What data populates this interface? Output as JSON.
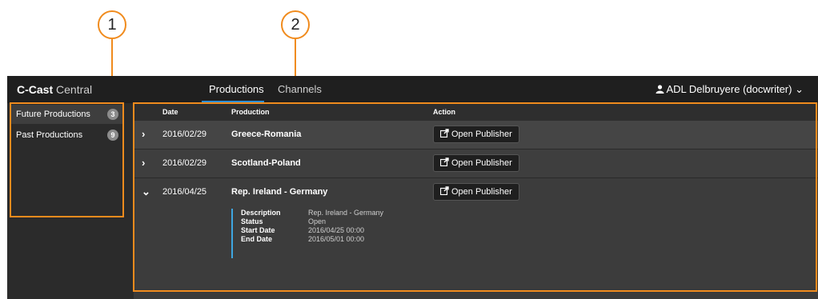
{
  "callouts": [
    "1",
    "2"
  ],
  "app": {
    "brand_bold": "C-Cast",
    "brand_light": "Central",
    "nav": [
      {
        "label": "Productions",
        "active": true
      },
      {
        "label": "Channels",
        "active": false
      }
    ],
    "user": {
      "icon": "user-icon",
      "label": "ADL Delbruyere (docwriter)",
      "caret": "⌄"
    }
  },
  "sidebar": {
    "items": [
      {
        "label": "Future Productions",
        "count": "3",
        "active": true
      },
      {
        "label": "Past Productions",
        "count": "9",
        "active": false
      }
    ]
  },
  "table": {
    "headers": {
      "date": "Date",
      "production": "Production",
      "action": "Action"
    },
    "action_button": {
      "icon": "external-link-icon",
      "label": "Open Publisher"
    },
    "rows": [
      {
        "chevron": "›",
        "date": "2016/02/29",
        "production": "Greece-Romania"
      },
      {
        "chevron": "›",
        "date": "2016/02/29",
        "production": "Scotland-Poland"
      },
      {
        "chevron": "⌄",
        "date": "2016/04/25",
        "production": "Rep. Ireland - Germany",
        "expanded": true,
        "details": [
          {
            "label": "Description",
            "value": "Rep. Ireland - Germany"
          },
          {
            "label": "Status",
            "value": "Open"
          },
          {
            "label": "Start Date",
            "value": "2016/04/25 00:00"
          },
          {
            "label": "End Date",
            "value": "2016/05/01 00:00"
          }
        ]
      }
    ]
  },
  "colors": {
    "callout": "#f08b1d",
    "nav_active_underline": "#2f8fd6",
    "detail_bar": "#3ea6e0",
    "app_background": "#2b2b2b"
  }
}
